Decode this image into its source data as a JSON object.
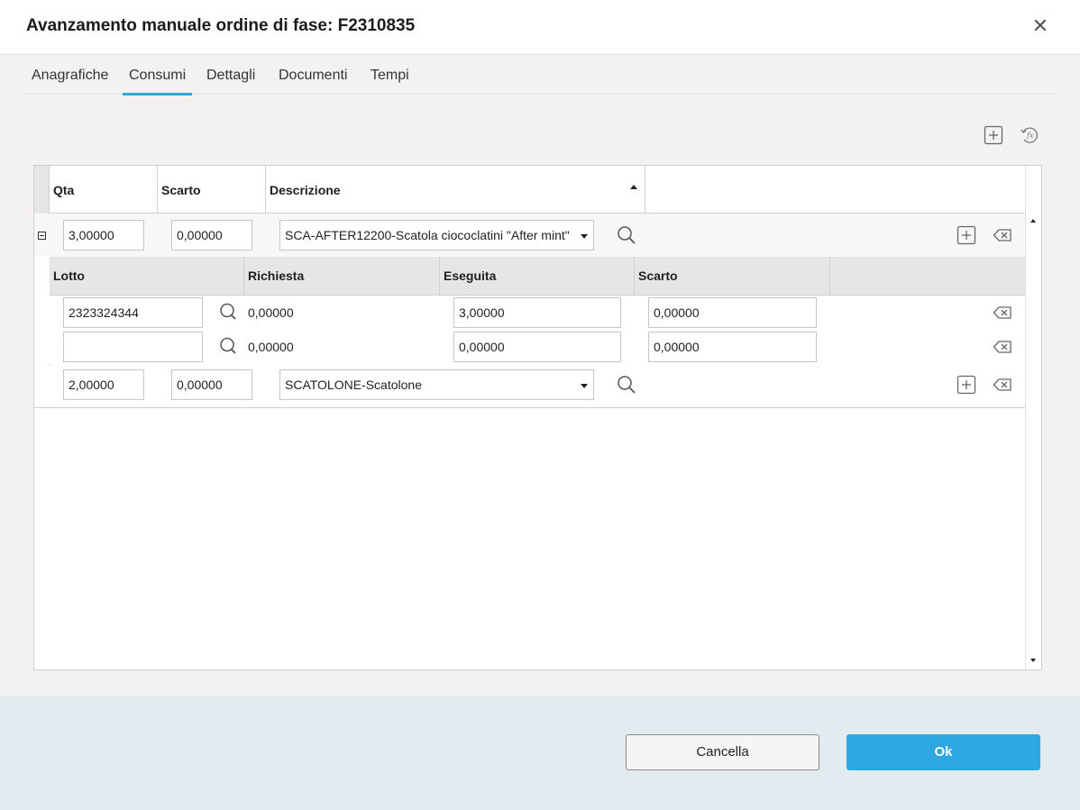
{
  "dialog": {
    "title": "Avanzamento manuale ordine di fase: F2310835",
    "close_icon": "close-icon"
  },
  "tabs": [
    {
      "label": "Anagrafiche",
      "active": false
    },
    {
      "label": "Consumi",
      "active": true
    },
    {
      "label": "Dettagli",
      "active": false
    },
    {
      "label": "Documenti",
      "active": false
    },
    {
      "label": "Tempi",
      "active": false
    }
  ],
  "toolbar": {
    "add_icon": "add-square-icon",
    "formula_icon": "formula-refresh-icon"
  },
  "grid": {
    "columns": [
      "Qta",
      "Scarto",
      "Descrizione"
    ],
    "sort_column": "Descrizione",
    "sort_direction": "ascending",
    "rows": [
      {
        "qta": "3,00000",
        "scarto": "0,00000",
        "descrizione": "SCA-AFTER12200-Scatola ciococlatini \"After mint\"",
        "expanded": true
      },
      {
        "qta": "2,00000",
        "scarto": "0,00000",
        "descrizione": "SCATOLONE-Scatolone",
        "expanded": false
      }
    ],
    "sub_grid": {
      "columns": [
        "Lotto",
        "Richiesta",
        "Eseguita",
        "Scarto"
      ],
      "rows": [
        {
          "lotto": "2323324344",
          "richiesta": "0,00000",
          "eseguita": "3,00000",
          "scarto": "0,00000"
        },
        {
          "lotto": "",
          "richiesta": "0,00000",
          "eseguita": "0,00000",
          "scarto": "0,00000"
        }
      ]
    }
  },
  "footer": {
    "cancel_label": "Cancella",
    "ok_label": "Ok",
    "ok_color": "#2ea7e0"
  }
}
